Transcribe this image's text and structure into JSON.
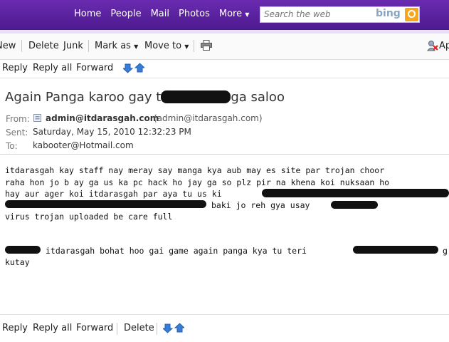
{
  "topnav": {
    "items": [
      "Home",
      "People",
      "Mail",
      "Photos",
      "More"
    ],
    "search_placeholder": "Search the web",
    "search_brand": "bing"
  },
  "toolbar": {
    "new_label": "New",
    "delete_label": "Delete",
    "junk_label": "Junk",
    "markas_label": "Mark as",
    "moveto_label": "Move to",
    "right_label": "Ap"
  },
  "actions": {
    "reply": "Reply",
    "reply_all": "Reply all",
    "forward": "Forward",
    "delete": "Delete"
  },
  "message": {
    "subject_start": "Again Panga karoo gay t",
    "subject_end": "ga saloo",
    "from_label": "From:",
    "from_name": "admin@itdarasgah.com",
    "from_email": "(admin@itdarasgah.com)",
    "sent_label": "Sent:",
    "sent_value": "Saturday, May 15, 2010 12:32:23 PM",
    "to_label": "To:",
    "to_value": "kabooter@Hotmail.com",
    "body": {
      "line1": "itdarasgah kay staff nay meray say manga kya aub may es site par trojan choor",
      "line2": "raha hon jo b ay ga us ka pc hack ho jay ga so plz pir na khena koi nuksaan ho",
      "line3": "hay aur ager koi itdarasgah par aya tu us ki",
      "line4": "baki jo reh gya usay",
      "line5": "virus trojan uploaded be care full",
      "line6": "itdarasgah bohat hoo gai game again panga kya tu teri",
      "line6_end": "g",
      "line7": "kutay"
    }
  },
  "colors": {
    "brand_purple": "#5b21a0",
    "link_blue": "#2b6cc4"
  }
}
